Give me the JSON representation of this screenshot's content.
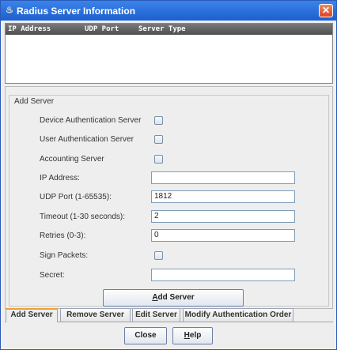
{
  "window": {
    "title": "Radius Server Information",
    "close_icon": "close-icon",
    "app_icon": "java-cup-icon"
  },
  "table": {
    "columns": [
      "IP Address",
      "UDP Port",
      "Server Type"
    ],
    "rows": []
  },
  "add_server": {
    "group_title": "Add Server",
    "fields": {
      "device_auth": {
        "label": "Device Authentication Server",
        "checked": false
      },
      "user_auth": {
        "label": "User Authentication Server",
        "checked": false
      },
      "accounting": {
        "label": "Accounting Server",
        "checked": false
      },
      "ip_address": {
        "label": "IP Address:",
        "value": ""
      },
      "udp_port": {
        "label": "UDP Port (1-65535):",
        "value": "1812"
      },
      "timeout": {
        "label": "Timeout (1-30 seconds):",
        "value": "2"
      },
      "retries": {
        "label": "Retries (0-3):",
        "value": "0"
      },
      "sign_packets": {
        "label": "Sign Packets:",
        "checked": false
      },
      "secret": {
        "label": "Secret:",
        "value": ""
      }
    },
    "add_button": {
      "label_mnemonic": "A",
      "label_rest": "dd Server"
    }
  },
  "tabs": [
    "Add Server",
    "Remove Server",
    "Edit Server",
    "Modify Authentication Order"
  ],
  "active_tab": 0,
  "footer": {
    "close_label": "Close",
    "help_mnemonic": "H",
    "help_rest": "elp"
  },
  "colors": {
    "title_bar": "#1c5fd0",
    "table_header": "#4e4e4e",
    "active_tab_accent": "#f0a030"
  }
}
